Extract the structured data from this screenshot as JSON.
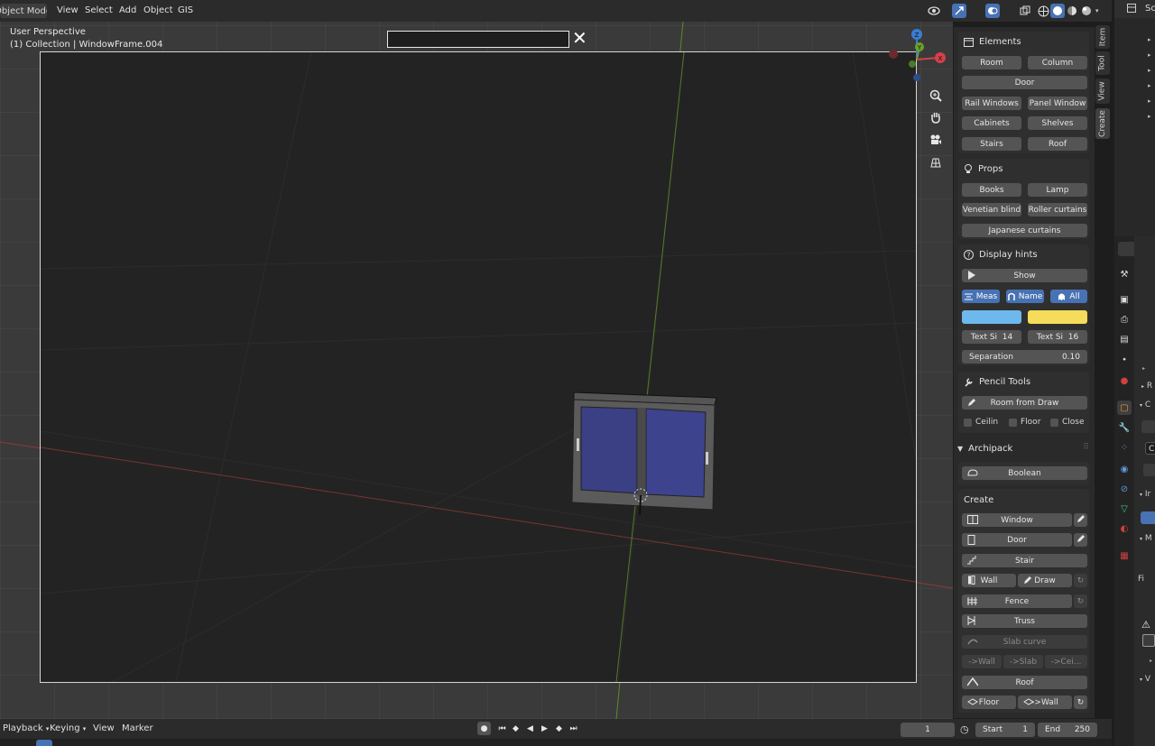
{
  "header": {
    "mode": "Object Mode",
    "menus": [
      "View",
      "Select",
      "Add",
      "Object",
      "GIS"
    ]
  },
  "viewport": {
    "perspective": "User Perspective",
    "collection": "(1) Collection | WindowFrame.004",
    "gizmo": {
      "z": "Z",
      "y": "Y",
      "x": "X"
    }
  },
  "side_tabs": [
    "Item",
    "Tool",
    "View",
    "Create"
  ],
  "npanel": {
    "elements": {
      "title": "Elements",
      "buttons": [
        "Room",
        "Column",
        "Door",
        "Rail Windows",
        "Panel Window",
        "Cabinets",
        "Shelves",
        "Stairs",
        "Roof"
      ]
    },
    "props": {
      "title": "Props",
      "buttons": [
        "Books",
        "Lamp",
        "Venetian blind",
        "Roller curtains",
        "Japanese curtains"
      ]
    },
    "hints": {
      "title": "Display hints",
      "show": "Show",
      "toggles": [
        "Meas",
        "Name",
        "All"
      ],
      "colors": [
        "#6db8ec",
        "#f5dc5a"
      ],
      "text_size_1": {
        "label": "Text Si",
        "value": "14"
      },
      "text_size_2": {
        "label": "Text Si",
        "value": "16"
      },
      "separation": {
        "label": "Separation",
        "value": "0.10"
      }
    },
    "pencil": {
      "title": "Pencil Tools",
      "room_from_draw": "Room from Draw",
      "checks": [
        "Ceilin",
        "Floor",
        "Close"
      ]
    },
    "archipack": {
      "title": "Archipack",
      "boolean": "Boolean",
      "create_title": "Create",
      "window": "Window",
      "door": "Door",
      "stair": "Stair",
      "wall": "Wall",
      "draw": "Draw",
      "fence": "Fence",
      "truss": "Truss",
      "slab_curve": "Slab curve",
      "to_wall": "->Wall",
      "to_slab": "->Slab",
      "to_cei": "->Cei...",
      "roof": "Roof",
      "floor": "Floor",
      "floor_to_wall": "->Wall"
    }
  },
  "timeline": {
    "menus": [
      "Playback",
      "Keying",
      "View",
      "Marker"
    ],
    "current_frame": "1",
    "start_label": "Start",
    "start_value": "1",
    "end_label": "End",
    "end_value": "250"
  },
  "right_edge": {
    "outliner_tab": "Sc",
    "props_letters": [
      "R",
      "C",
      "C",
      "Ir",
      "M",
      "Fi",
      "V"
    ]
  }
}
